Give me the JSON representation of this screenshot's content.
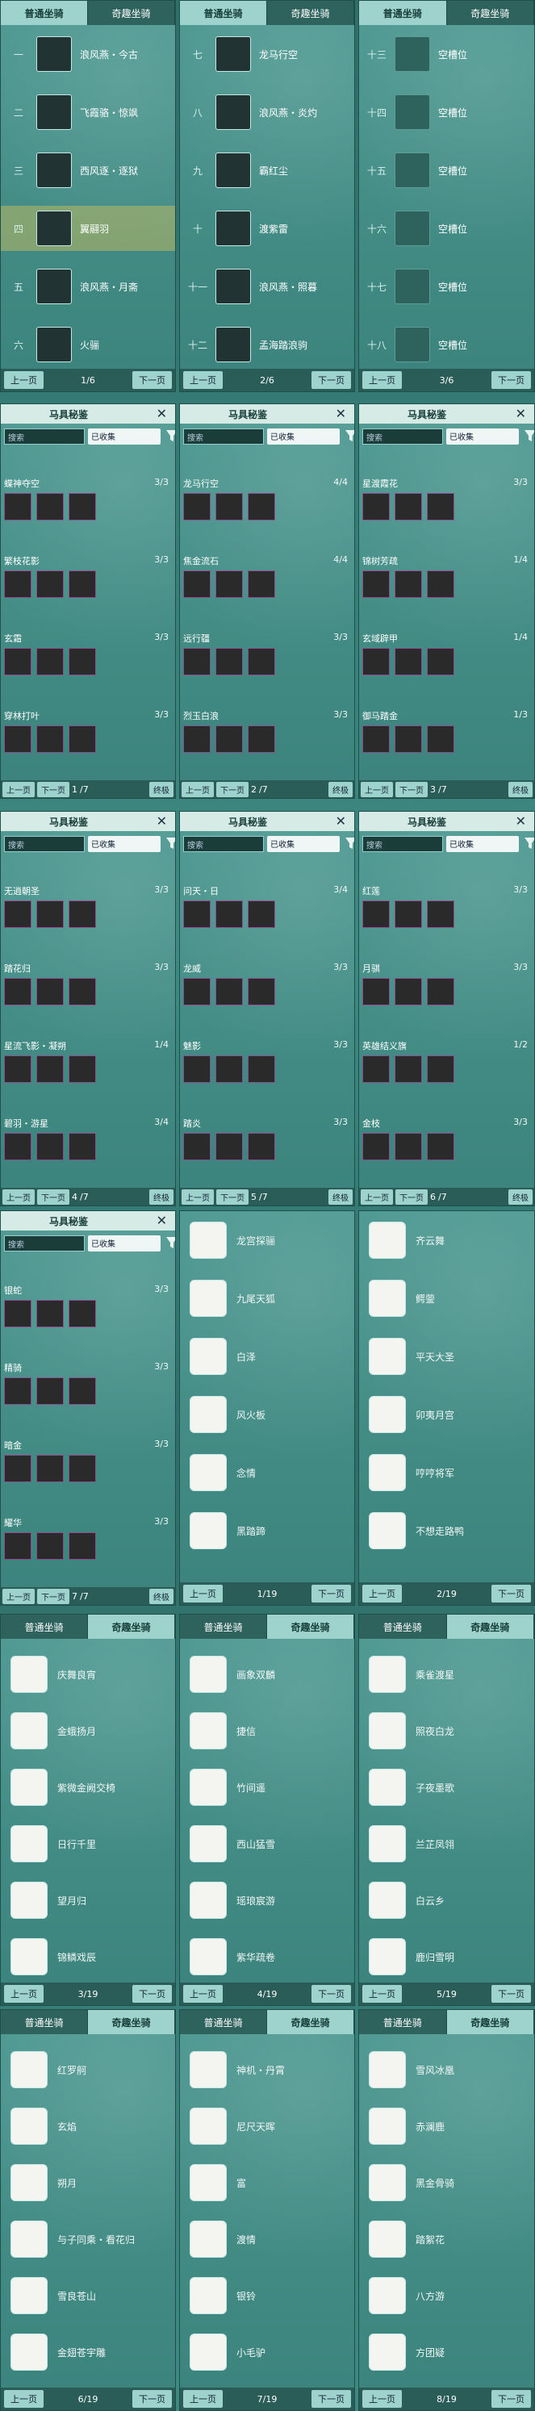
{
  "tabs": {
    "normal": "普通坐骑",
    "special": "奇趣坐骑"
  },
  "pager": {
    "prev": "上一页",
    "next": "下一页"
  },
  "mounts": {
    "p1": {
      "page": "1/6",
      "rows": [
        {
          "idx": "一",
          "name": "浪风燕・今古"
        },
        {
          "idx": "二",
          "name": "飞霞骆・惊飒"
        },
        {
          "idx": "三",
          "name": "西风逐・逐狱"
        },
        {
          "idx": "四",
          "name": "翼翮羽"
        },
        {
          "idx": "五",
          "name": "浪风燕・月斋"
        },
        {
          "idx": "六",
          "name": "火骊"
        }
      ]
    },
    "p2": {
      "page": "2/6",
      "rows": [
        {
          "idx": "七",
          "name": "龙马行空"
        },
        {
          "idx": "八",
          "name": "浪风燕・炎灼"
        },
        {
          "idx": "九",
          "name": "霸红尘"
        },
        {
          "idx": "十",
          "name": "渡紫雷"
        },
        {
          "idx": "十一",
          "name": "浪风燕・照暮"
        },
        {
          "idx": "十二",
          "name": "孟海踏浪驹"
        }
      ]
    },
    "p3": {
      "page": "3/6",
      "rows": [
        {
          "idx": "十三",
          "name": "空槽位"
        },
        {
          "idx": "十四",
          "name": "空槽位"
        },
        {
          "idx": "十五",
          "name": "空槽位"
        },
        {
          "idx": "十六",
          "name": "空槽位"
        },
        {
          "idx": "十七",
          "name": "空槽位"
        },
        {
          "idx": "十八",
          "name": "空槽位"
        }
      ]
    }
  },
  "collection": {
    "title": "马具秘鉴",
    "search": "搜索",
    "filter": "已收集",
    "end": "终极",
    "total": "/7",
    "panels": [
      {
        "page": "1",
        "sets": [
          {
            "name": "蝶神夺空",
            "prog": "3/3"
          },
          {
            "name": "繁枝花影",
            "prog": "3/3"
          },
          {
            "name": "玄霜",
            "prog": "3/3"
          },
          {
            "name": "穿林打叶",
            "prog": "3/3"
          }
        ]
      },
      {
        "page": "2",
        "sets": [
          {
            "name": "龙马行空",
            "prog": "4/4"
          },
          {
            "name": "焦金流石",
            "prog": "4/4"
          },
          {
            "name": "远行疆",
            "prog": "3/3"
          },
          {
            "name": "烈玉白浪",
            "prog": "3/3"
          }
        ]
      },
      {
        "page": "3",
        "sets": [
          {
            "name": "星渡霞花",
            "prog": "3/3"
          },
          {
            "name": "锦树芳疏",
            "prog": "1/4"
          },
          {
            "name": "玄域辟甲",
            "prog": "1/4"
          },
          {
            "name": "御马踏金",
            "prog": "1/3"
          }
        ]
      },
      {
        "page": "4",
        "sets": [
          {
            "name": "无逍朝圣",
            "prog": "3/3"
          },
          {
            "name": "踏花归",
            "prog": "3/3"
          },
          {
            "name": "星流飞影・凝朔",
            "prog": "1/4"
          },
          {
            "name": "碧羽・游星",
            "prog": "3/4"
          }
        ]
      },
      {
        "page": "5",
        "sets": [
          {
            "name": "问天・日",
            "prog": "3/4"
          },
          {
            "name": "龙威",
            "prog": "3/3"
          },
          {
            "name": "魅影",
            "prog": "3/3"
          },
          {
            "name": "踏炎",
            "prog": "3/3"
          }
        ]
      },
      {
        "page": "6",
        "sets": [
          {
            "name": "红莲",
            "prog": "3/3"
          },
          {
            "name": "月骐",
            "prog": "3/3"
          },
          {
            "name": "英雄结义旗",
            "prog": "1/2"
          },
          {
            "name": "金枝",
            "prog": "3/3"
          }
        ]
      },
      {
        "page": "7",
        "sets": [
          {
            "name": "银蛇",
            "prog": "3/3"
          },
          {
            "name": "精骑",
            "prog": "3/3"
          },
          {
            "name": "暗金",
            "prog": "3/3"
          },
          {
            "name": "耀华",
            "prog": "3/3"
          }
        ]
      }
    ]
  },
  "special": [
    {
      "page": "1/19",
      "items": [
        "龙宫探骊",
        "九尾天狐",
        "白泽",
        "风火板",
        "念情",
        "黑踏蹄"
      ]
    },
    {
      "page": "2/19",
      "items": [
        "齐云舞",
        "鳄蓥",
        "平天大圣",
        "卯夷月宫",
        "哼哼将军",
        "不想走路鸭"
      ]
    },
    {
      "page": "3/19",
      "items": [
        "庆舞良宵",
        "金蛾扬月",
        "紫微金阙交椅",
        "日行千里",
        "望月归",
        "锦鳞戏辰"
      ]
    },
    {
      "page": "4/19",
      "items": [
        "画象双麟",
        "捷信",
        "竹间遥",
        "西山猛雪",
        "瑶琅宸游",
        "紫华疏卷"
      ]
    },
    {
      "page": "5/19",
      "items": [
        "乘雀渡星",
        "照夜白龙",
        "子夜墨歌",
        "兰芷凤翎",
        "白云乡",
        "鹿归雪明"
      ]
    },
    {
      "page": "6/19",
      "items": [
        "红罗舸",
        "玄焰",
        "朔月",
        "与子同乘・看花归",
        "雪良苍山",
        "金翅苍宇雕"
      ]
    },
    {
      "page": "7/19",
      "items": [
        "神机・丹霄",
        "尼尺天晖",
        "富",
        "渡情",
        "银铃",
        "小毛驴"
      ]
    },
    {
      "page": "8/19",
      "items": [
        "雪风冰凰",
        "赤澜鹿",
        "黑金骨骑",
        "踏絮花",
        "八方游",
        "方团疑"
      ]
    }
  ]
}
